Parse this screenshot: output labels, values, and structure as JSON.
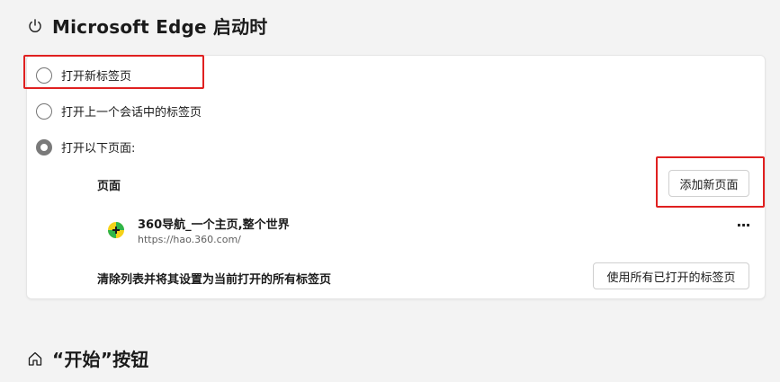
{
  "startup": {
    "title": "Microsoft Edge 启动时",
    "icon": "power-icon",
    "options": [
      {
        "label": "打开新标签页",
        "selected": false
      },
      {
        "label": "打开上一个会话中的标签页",
        "selected": false
      },
      {
        "label": "打开以下页面:",
        "selected": true
      }
    ],
    "pages_label": "页面",
    "add_page_button": "添加新页面",
    "pages": [
      {
        "title": "360导航_一个主页,整个世界",
        "url": "https://hao.360.com/",
        "icon": "360-site-icon"
      }
    ],
    "more_label": "···",
    "clear_label": "清除列表并将其设置为当前打开的所有标签页",
    "use_open_tabs_button": "使用所有已打开的标签页"
  },
  "start_button_section": {
    "title": "“开始”按钮",
    "icon": "home-icon"
  },
  "colors": {
    "background": "#f3f3f3",
    "highlight": "#e02020",
    "radio_selected": "#7a7a7a"
  }
}
